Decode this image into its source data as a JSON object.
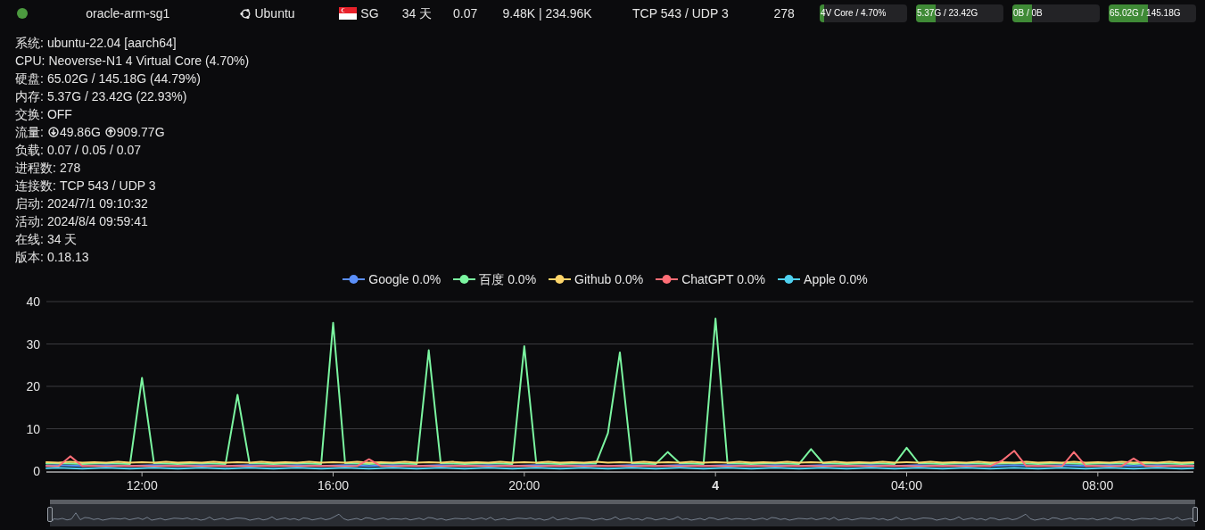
{
  "server": {
    "online": true,
    "name": "oracle-arm-sg1",
    "os": "Ubuntu",
    "region": "SG",
    "uptime": "34 天",
    "load": "0.07",
    "traffic": "9.48K | 234.96K",
    "connections": "TCP 543 / UDP 3",
    "processes": "278",
    "bars": [
      {
        "label": "4V Core / 4.70%",
        "level": 0.047
      },
      {
        "label": "5.37G / 23.42G",
        "level": 0.229
      },
      {
        "label": "0B / 0B",
        "level": 0.22
      },
      {
        "label": "65.02G / 145.18G",
        "level": 0.448
      }
    ]
  },
  "details": [
    {
      "kind": "text",
      "label": "系统:",
      "value": "ubuntu-22.04 [aarch64]"
    },
    {
      "kind": "text",
      "label": "CPU:",
      "value": "Neoverse-N1 4 Virtual Core (4.70%)"
    },
    {
      "kind": "text",
      "label": "硬盘:",
      "value": "65.02G / 145.18G (44.79%)"
    },
    {
      "kind": "text",
      "label": "内存:",
      "value": "5.37G / 23.42G (22.93%)"
    },
    {
      "kind": "text",
      "label": "交换:",
      "value": "OFF"
    },
    {
      "kind": "traffic",
      "label": "流量:",
      "down": "49.86G",
      "up": "909.77G"
    },
    {
      "kind": "text",
      "label": "负载:",
      "value": "0.07 / 0.05 / 0.07"
    },
    {
      "kind": "text",
      "label": "进程数:",
      "value": "278"
    },
    {
      "kind": "text",
      "label": "连接数:",
      "value": "TCP 543 / UDP 3"
    },
    {
      "kind": "text",
      "label": "启动:",
      "value": "2024/7/1 09:10:32"
    },
    {
      "kind": "text",
      "label": "活动:",
      "value": "2024/8/4 09:59:41"
    },
    {
      "kind": "text",
      "label": "在线:",
      "value": "34 天"
    },
    {
      "kind": "text",
      "label": "版本:",
      "value": "0.18.13"
    }
  ],
  "chart": {
    "chart_data": {
      "type": "line",
      "grid": true,
      "categories": [
        null,
        null,
        null,
        null,
        null,
        null,
        null,
        null,
        "12:00",
        null,
        null,
        null,
        null,
        null,
        null,
        null,
        null,
        null,
        null,
        null,
        null,
        null,
        null,
        null,
        "16:00",
        null,
        null,
        null,
        null,
        null,
        null,
        null,
        null,
        null,
        null,
        null,
        null,
        null,
        null,
        null,
        "20:00",
        null,
        null,
        null,
        null,
        null,
        null,
        null,
        null,
        null,
        null,
        null,
        null,
        null,
        null,
        null,
        "4",
        null,
        null,
        null,
        null,
        null,
        null,
        null,
        null,
        null,
        null,
        null,
        null,
        null,
        null,
        null,
        "04:00",
        null,
        null,
        null,
        null,
        null,
        null,
        null,
        null,
        null,
        null,
        null,
        null,
        null,
        null,
        null,
        "08:00",
        null,
        null,
        null,
        null,
        null,
        null,
        null,
        null
      ],
      "ylim": [
        0,
        40
      ],
      "yticks": [
        0,
        10,
        20,
        30,
        40
      ],
      "series": [
        {
          "name": "Google 0.0%",
          "color": "#5b8ff9",
          "values": [
            1.3,
            1.4,
            1.3,
            1.2,
            1.3,
            1.4,
            1.3,
            1.2,
            1.3,
            1.4,
            1.3,
            1.2,
            1.3,
            1.4,
            1.3,
            1.2,
            1.3,
            1.4,
            1.3,
            1.2,
            1.3,
            1.4,
            1.3,
            1.2,
            1.3,
            1.4,
            1.3,
            1.2,
            1.3,
            1.4,
            1.3,
            1.2,
            1.3,
            1.4,
            1.3,
            1.2,
            1.3,
            1.4,
            1.3,
            1.2,
            1.3,
            1.4,
            1.3,
            1.2,
            1.3,
            1.4,
            1.3,
            1.2,
            1.3,
            1.4,
            1.3,
            1.2,
            1.3,
            1.4,
            1.3,
            1.2,
            1.3,
            1.4,
            1.3,
            1.2,
            1.3,
            1.4,
            1.3,
            1.2,
            1.3,
            1.4,
            1.3,
            1.2,
            1.3,
            1.4,
            1.3,
            1.2,
            1.3,
            1.4,
            1.3,
            1.2,
            1.3,
            1.4,
            1.3,
            1.2,
            1.3,
            1.4,
            1.3,
            1.2,
            1.3,
            1.4,
            1.3,
            1.2,
            1.3,
            1.4,
            1.3,
            1.2,
            1.3,
            1.4,
            1.3,
            1.2,
            1.3
          ]
        },
        {
          "name": "百度 0.0%",
          "color": "#7bf5a0",
          "values": [
            1.8,
            1.9,
            1.8,
            1.7,
            1.8,
            1.9,
            1.8,
            1.7,
            22,
            1.9,
            1.8,
            1.7,
            1.8,
            1.9,
            1.8,
            1.7,
            18,
            1.9,
            1.8,
            1.7,
            1.8,
            1.9,
            1.8,
            1.7,
            35,
            1.9,
            1.8,
            1.7,
            1.8,
            1.9,
            1.8,
            1.7,
            28.5,
            1.9,
            1.8,
            1.7,
            1.8,
            1.9,
            1.8,
            1.7,
            29.5,
            1.9,
            1.8,
            1.7,
            1.8,
            1.9,
            1.8,
            9,
            28,
            1.9,
            1.8,
            1.7,
            4.5,
            1.9,
            1.8,
            1.7,
            36,
            1.9,
            1.8,
            1.7,
            1.8,
            1.9,
            1.8,
            1.7,
            5.2,
            1.9,
            1.8,
            1.7,
            1.8,
            1.9,
            1.8,
            1.7,
            5.5,
            1.9,
            1.8,
            1.7,
            1.8,
            1.9,
            1.8,
            1.7,
            1.8,
            1.9,
            1.8,
            1.7,
            1.8,
            1.9,
            1.8,
            1.7,
            1.8,
            1.9,
            1.8,
            1.7,
            1.8,
            1.9,
            1.8,
            1.7,
            1.8
          ]
        },
        {
          "name": "Github 0.0%",
          "color": "#fdd56a",
          "values": [
            2.1,
            2.0,
            2.2,
            2.0,
            2.1,
            2.0,
            2.2,
            2.0,
            2.1,
            2.0,
            2.2,
            2.0,
            2.1,
            2.0,
            2.2,
            2.0,
            2.1,
            2.0,
            2.2,
            2.0,
            2.1,
            2.0,
            2.2,
            2.0,
            2.1,
            2.0,
            2.2,
            2.0,
            2.1,
            2.0,
            2.2,
            2.0,
            2.1,
            2.0,
            2.2,
            2.0,
            2.1,
            2.0,
            2.2,
            2.0,
            2.1,
            2.0,
            2.2,
            2.0,
            2.1,
            2.0,
            2.2,
            2.0,
            2.1,
            2.0,
            2.2,
            2.0,
            2.1,
            2.0,
            2.2,
            2.0,
            2.1,
            2.0,
            2.2,
            2.0,
            2.1,
            2.0,
            2.2,
            2.0,
            2.1,
            2.0,
            2.2,
            2.0,
            2.1,
            2.0,
            2.2,
            2.0,
            2.1,
            2.0,
            2.2,
            2.0,
            2.1,
            2.0,
            2.2,
            2.0,
            2.1,
            2.0,
            2.2,
            2.0,
            2.1,
            2.0,
            2.2,
            2.0,
            2.1,
            2.0,
            2.2,
            2.0,
            2.1,
            2.0,
            2.2,
            2.0,
            2.1
          ]
        },
        {
          "name": "ChatGPT 0.0%",
          "color": "#ff6e76",
          "values": [
            1.2,
            1.1,
            3.5,
            1.2,
            1.2,
            1.1,
            1.2,
            1.2,
            1.2,
            1.1,
            1.2,
            1.2,
            1.2,
            1.1,
            1.2,
            1.2,
            1.2,
            1.1,
            1.2,
            1.2,
            1.2,
            1.1,
            1.2,
            1.2,
            1.2,
            1.1,
            1.2,
            2.8,
            1.2,
            1.1,
            1.2,
            1.2,
            1.2,
            1.1,
            1.2,
            1.2,
            1.2,
            1.1,
            1.2,
            1.2,
            1.2,
            1.1,
            1.2,
            1.2,
            1.2,
            1.1,
            1.2,
            1.2,
            1.2,
            1.1,
            1.2,
            1.2,
            1.2,
            1.1,
            1.2,
            1.2,
            1.2,
            1.1,
            1.2,
            1.2,
            1.2,
            1.1,
            1.2,
            1.2,
            1.2,
            1.1,
            1.2,
            1.2,
            1.2,
            1.1,
            1.2,
            1.2,
            1.2,
            1.1,
            1.2,
            1.2,
            1.2,
            1.1,
            1.2,
            1.2,
            2.5,
            4.8,
            1.2,
            1.2,
            1.2,
            1.1,
            4.5,
            1.2,
            1.2,
            1.1,
            1.2,
            3,
            1.2,
            1.1,
            1.2,
            1.2,
            1.2
          ]
        },
        {
          "name": "Apple 0.0%",
          "color": "#4fd1f0",
          "values": [
            0.7,
            0.8,
            0.7,
            0.6,
            0.7,
            0.8,
            0.7,
            0.6,
            0.7,
            0.8,
            0.7,
            0.6,
            0.7,
            0.8,
            0.7,
            0.6,
            0.7,
            0.8,
            0.7,
            0.6,
            0.7,
            0.8,
            0.7,
            0.6,
            0.7,
            0.8,
            0.7,
            0.6,
            0.7,
            0.8,
            0.7,
            0.6,
            0.7,
            0.8,
            0.7,
            0.6,
            0.7,
            0.8,
            0.7,
            0.6,
            0.7,
            0.8,
            0.7,
            0.6,
            0.7,
            0.8,
            0.7,
            0.6,
            0.7,
            0.8,
            0.7,
            0.6,
            0.7,
            0.8,
            0.7,
            0.6,
            0.7,
            0.8,
            0.7,
            0.6,
            0.7,
            0.8,
            0.7,
            0.6,
            0.7,
            0.8,
            0.7,
            0.6,
            0.7,
            0.8,
            0.7,
            0.6,
            0.7,
            0.8,
            0.7,
            0.6,
            0.7,
            0.8,
            0.7,
            0.6,
            0.7,
            0.8,
            0.7,
            0.6,
            0.7,
            0.8,
            0.7,
            0.6,
            0.7,
            0.8,
            0.7,
            0.6,
            0.7,
            0.8,
            0.7,
            0.6,
            0.7
          ]
        }
      ]
    }
  },
  "zoom_slider": {
    "level": 1
  }
}
